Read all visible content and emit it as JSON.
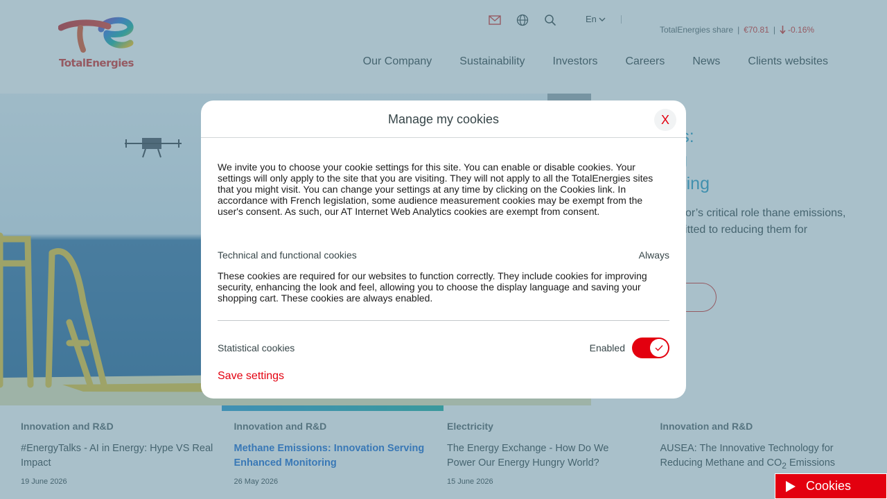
{
  "brand": {
    "name": "TotalEnergies"
  },
  "header": {
    "icons": [
      "mail-icon",
      "globe-icon",
      "search-icon"
    ],
    "language": "En",
    "share": {
      "label": "TotalEnergies share",
      "price": "€70.81",
      "delta": "-0.16%"
    },
    "nav": [
      "Our Company",
      "Sustainability",
      "Investors",
      "Careers",
      "News",
      "Clients websites"
    ]
  },
  "hero": {
    "title": "e Emissions: tion Serving ced Monitoring",
    "description": "the Oil & Gas sector’s critical role thane emissions, TotalEnergies mmitted to reducing them for",
    "button": "ore"
  },
  "cards": [
    {
      "category": "Innovation and R&D",
      "title": "#EnergyTalks - AI in Energy: Hype VS Real Impact",
      "date": "19 June 2026"
    },
    {
      "category": "Innovation and R&D",
      "title": "Methane Emissions: Innovation Serving Enhanced Monitoring",
      "date": "26 May 2026"
    },
    {
      "category": "Electricity",
      "title": "The Energy Exchange - How Do We Power Our Energy Hungry World?",
      "date": "15 June 2026"
    },
    {
      "category": "Innovation and R&D",
      "title_prefix": "AUSEA: The Innovative Technology for Reducing Methane and CO",
      "title_sub": "2",
      "title_suffix": " Emissions",
      "date": ""
    }
  ],
  "modal": {
    "title": "Manage my cookies",
    "close": "X",
    "intro": "We invite you to choose your cookie settings for this site. You can enable or disable cookies. Your settings will only apply to the site that you are visiting. They will not apply to all the TotalEnergies sites that you might visit. You can change your settings at any time by clicking on the Cookies link. In accordance with French legislation, some audience measurement cookies may be exempt from the user's consent. As such, our AT Internet Web Analytics cookies are exempt from consent.",
    "technical": {
      "title": "Technical and functional cookies",
      "status": "Always",
      "description": "These cookies are required for our websites to function correctly. They include cookies for improving security, enhancing the look and feel, allowing you to choose the display language and saving your shopping cart. These cookies are always enabled."
    },
    "statistical": {
      "title": "Statistical cookies",
      "status": "Enabled",
      "enabled": true
    },
    "save": "Save settings"
  },
  "cookies_button": "Cookies",
  "colors": {
    "brand_red": "#e3000f",
    "overlay": "#5a8496",
    "link_blue": "#1f6fd6",
    "hero_title": "#2e9fc7"
  }
}
